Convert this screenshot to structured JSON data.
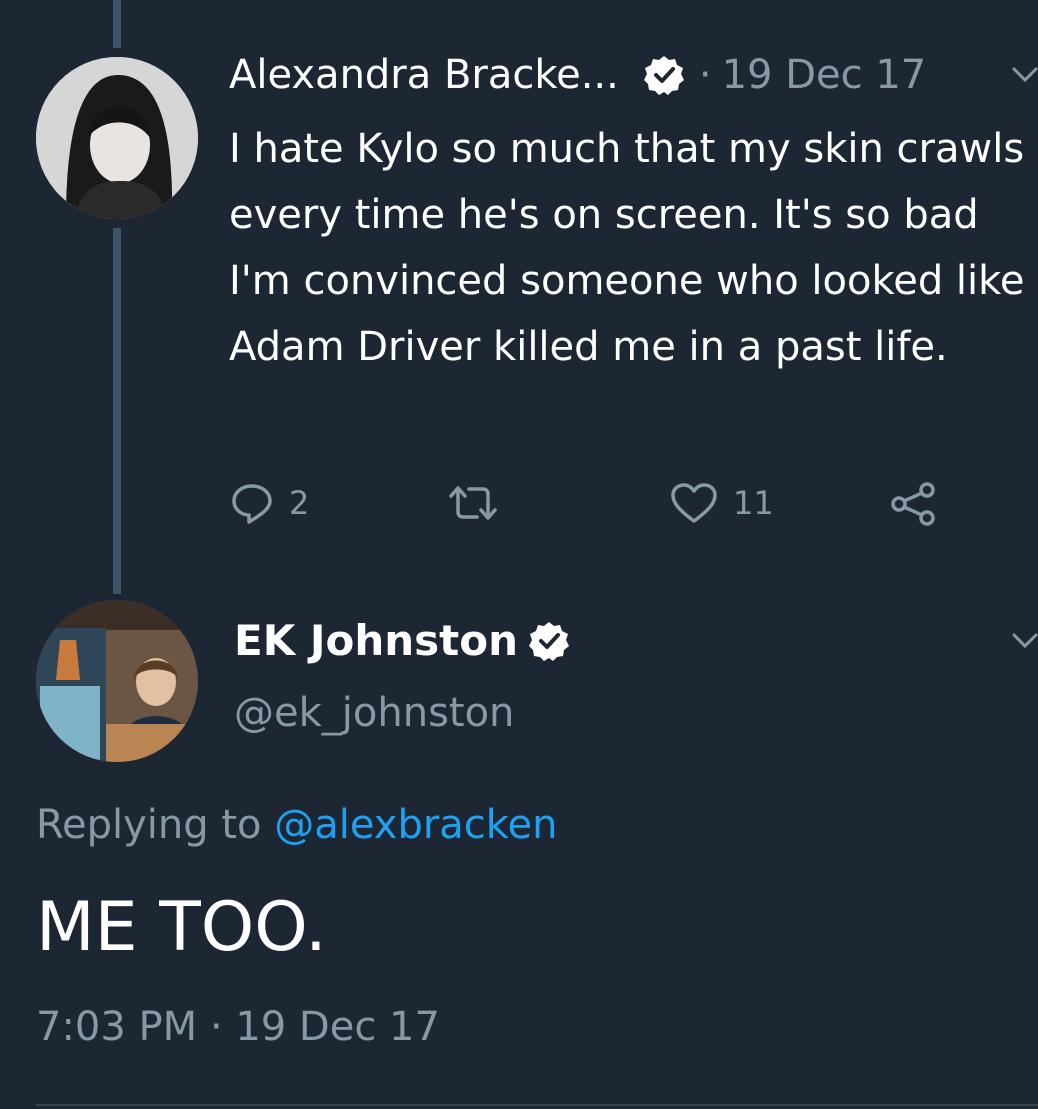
{
  "colors": {
    "background": "#1c2733",
    "text": "#ffffff",
    "secondary": "#8899a6",
    "link": "#1da1f2",
    "thread_line": "#3d5466"
  },
  "parent_tweet": {
    "author_name": "Alexandra Bracke...",
    "verified_icon": "verified-badge-icon",
    "separator": "·",
    "date": "19 Dec 17",
    "body": "I hate Kylo so much that my skin crawls every time he's on screen. It's so bad I'm convinced someone who looked like Adam Driver killed me in a past life.",
    "actions": {
      "reply_icon": "reply-icon",
      "reply_count": "2",
      "retweet_icon": "retweet-icon",
      "like_icon": "heart-icon",
      "like_count": "11",
      "share_icon": "share-icon"
    }
  },
  "reply_tweet": {
    "author_name": "EK Johnston",
    "verified_icon": "verified-badge-icon",
    "handle": "@ek_johnston",
    "replying_prefix": "Replying to",
    "replying_mention": "@alexbracken",
    "body": "ME TOO.",
    "timestamp": "7:03 PM · 19 Dec 17"
  }
}
